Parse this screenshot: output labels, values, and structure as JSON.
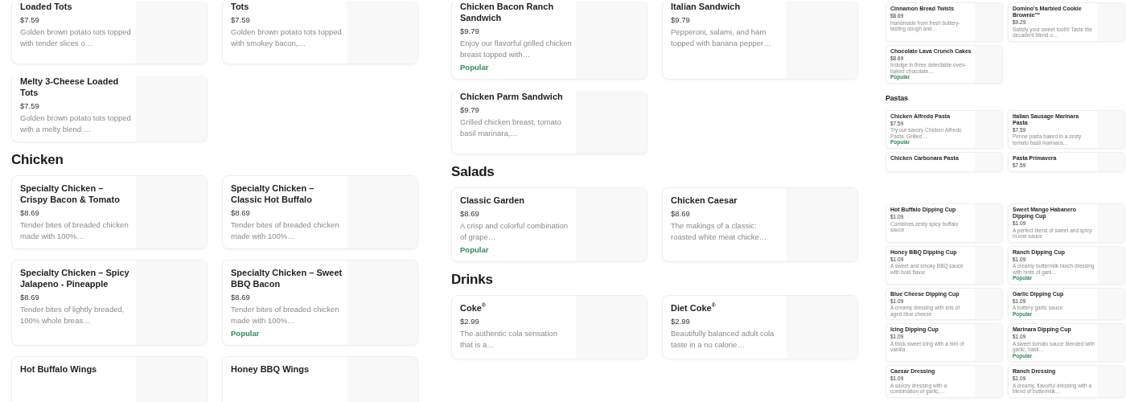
{
  "screens": [
    {
      "sections": [
        {
          "items": [
            {
              "name": "Loaded Tots",
              "price": "$7.59",
              "description": "Golden brown potato tots topped with tender slices o…"
            },
            {
              "name": "Tots",
              "price": "$7.59",
              "description": "Golden brown potato tots topped with smokey bacon,…"
            },
            {
              "name": "Melty 3-Cheese Loaded Tots",
              "price": "$7.59",
              "description": "Golden brown potato tots topped with a melty blend …"
            }
          ]
        },
        {
          "heading": "Chicken",
          "items": [
            {
              "name": "Specialty Chicken – Crispy Bacon & Tomato",
              "price": "$8.69",
              "description": "Tender bites of breaded chicken made with 100%…"
            },
            {
              "name": "Specialty Chicken – Classic Hot Buffalo",
              "price": "$8.69",
              "description": "Tender bites of breaded chicken made with 100%…"
            },
            {
              "name": "Specialty Chicken – Spicy Jalapeno - Pineapple",
              "price": "$8.69",
              "description": "Tender bites of lightly breaded, 100% whole breas…"
            },
            {
              "name": "Specialty Chicken – Sweet BBQ Bacon",
              "price": "$8.69",
              "description": "Tender bites of breaded chicken made with 100%…",
              "badge": "Popular"
            },
            {
              "name": "Hot Buffalo Wings"
            },
            {
              "name": "Honey BBQ Wings"
            }
          ]
        }
      ]
    },
    {
      "sections": [
        {
          "items": [
            {
              "name": "Chicken Bacon Ranch Sandwich",
              "price": "$9.79",
              "description": "Enjoy our flavorful grilled chicken breast topped with…",
              "badge": "Popular"
            },
            {
              "name": "Italian Sandwich",
              "price": "$9.79",
              "description": "Pepperoni, salami, and ham topped with banana pepper…"
            },
            {
              "name": "Chicken Parm Sandwich",
              "price": "$9.79",
              "description": "Grilled chicken breast, tomato basil marinara,…"
            }
          ]
        },
        {
          "heading": "Salads",
          "items": [
            {
              "name": "Classic Garden",
              "price": "$8.69",
              "description": "A crisp and colorful combination of grape…",
              "badge": "Popular"
            },
            {
              "name": "Chicken Caesar",
              "price": "$8.69",
              "description": "The makings of a classic: roasted white meat chicke…"
            }
          ]
        },
        {
          "heading": "Drinks",
          "items": [
            {
              "name": "Coke$^{®}$",
              "price": "$2.99",
              "description": "The authentic cola sensation that is a…"
            },
            {
              "name": "Diet Coke$^{®}$",
              "price": "$2.99",
              "description": "Beautifully balanced adult cola taste in a no calorie…"
            }
          ]
        }
      ]
    },
    {
      "sections": [
        {
          "items": [
            {
              "name": "Cinnamon Bread Twists",
              "price": "$8.69",
              "description": "Handmade from fresh buttery-tasting dough and…"
            },
            {
              "name": "Domino's Marbled Cookie Brownie™",
              "price": "$9.29",
              "description": "Satisfy your sweet tooth! Taste the decadent blend o…"
            },
            {
              "name": "Chocolate Lava Crunch Cakes",
              "price": "$8.69",
              "description": "Indulge in three delectable oven-baked chocolate…",
              "badge": "Popular"
            }
          ]
        },
        {
          "heading": "Pastas",
          "items": [
            {
              "name": "Chicken Alfredo Pasta",
              "price": "$7.59",
              "description": "Try our savory Chicken Alfredo Pasta. Grilled…",
              "badge": "Popular"
            },
            {
              "name": "Italian Sausage Marinara Pasta",
              "price": "$7.59",
              "description": "Penne pasta baked in a zesty tomato basil marinara…"
            },
            {
              "name": "Chicken Carbonara Pasta"
            },
            {
              "name": "Pasta Primavera",
              "price": "$7.59"
            }
          ]
        }
      ]
    },
    {
      "sections": [
        {
          "items": [
            {
              "name": "Hot Buffalo Dipping Cup",
              "price": "$1.09",
              "description": "Combines zesty spicy buffalo sauce"
            },
            {
              "name": "Sweet Mango Habanero Dipping Cup",
              "price": "$1.09",
              "description": "A perfect blend of sweet and spicy in one sauce"
            },
            {
              "name": "Honey BBQ Dipping Cup",
              "price": "$1.09",
              "description": "A sweet and smoky BBQ sauce with bold flavor"
            },
            {
              "name": "Ranch Dipping Cup",
              "price": "$1.09",
              "description": "A creamy buttermilk ranch dressing with hints of garli…",
              "badge": "Popular"
            },
            {
              "name": "Blue Cheese Dipping Cup",
              "price": "$1.09",
              "description": "A creamy dressing with lots of aged blue cheese"
            },
            {
              "name": "Garlic Dipping Cup",
              "price": "$1.09",
              "description": "A buttery garlic sauce",
              "badge": "Popular"
            },
            {
              "name": "Icing Dipping Cup",
              "price": "$1.09",
              "description": "A thick sweet icing with a hint of vanilla"
            },
            {
              "name": "Marinara Dipping Cup",
              "price": "$1.09",
              "description": "A sweet tomato sauce blended with garlic, basil…",
              "badge": "Popular"
            },
            {
              "name": "Caesar Dressing",
              "price": "$1.09",
              "description": "A savory dressing with a combination of garlic,…"
            },
            {
              "name": "Ranch Dressing",
              "price": "$1.09",
              "description": "A creamy, flavorful dressing with a blend of buttermilk…"
            }
          ]
        }
      ]
    }
  ]
}
